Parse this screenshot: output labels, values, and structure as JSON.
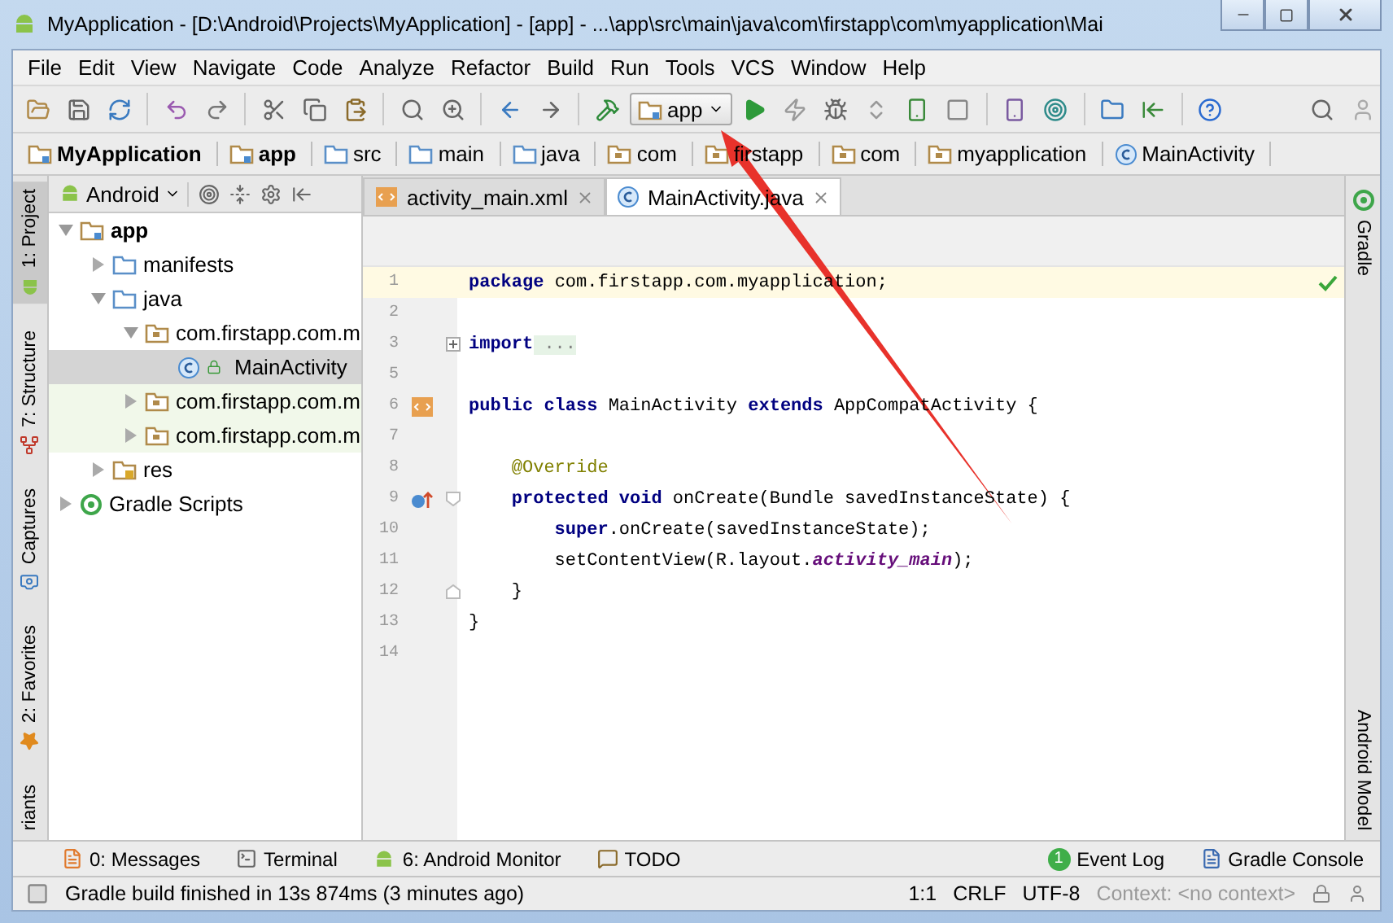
{
  "window": {
    "title": "MyApplication - [D:\\Android\\Projects\\MyApplication] - [app] - ...\\app\\src\\main\\java\\com\\firstapp\\com\\myapplication\\Mai"
  },
  "menu": [
    "File",
    "Edit",
    "View",
    "Navigate",
    "Code",
    "Analyze",
    "Refactor",
    "Build",
    "Run",
    "Tools",
    "VCS",
    "Window",
    "Help"
  ],
  "toolbar": {
    "run_config": "app"
  },
  "breadcrumbs": [
    {
      "label": "MyApplication",
      "kind": "module"
    },
    {
      "label": "app",
      "kind": "module"
    },
    {
      "label": "src",
      "kind": "folder"
    },
    {
      "label": "main",
      "kind": "folder"
    },
    {
      "label": "java",
      "kind": "source"
    },
    {
      "label": "com",
      "kind": "package"
    },
    {
      "label": "firstapp",
      "kind": "package"
    },
    {
      "label": "com",
      "kind": "package"
    },
    {
      "label": "myapplication",
      "kind": "package"
    },
    {
      "label": "MainActivity",
      "kind": "class"
    }
  ],
  "left_tool_tabs": [
    {
      "label": "1: Project",
      "selected": true,
      "kind": "android"
    },
    {
      "label": "7: Structure",
      "selected": false,
      "kind": "structure"
    },
    {
      "label": "Captures",
      "selected": false,
      "kind": "camera"
    },
    {
      "label": "2: Favorites",
      "selected": false,
      "kind": "star"
    },
    {
      "label": "riants",
      "selected": false,
      "kind": "none"
    }
  ],
  "project_panel": {
    "view": "Android",
    "tree": [
      {
        "label": "app",
        "kind": "module",
        "expanded": true,
        "selected": false,
        "children": [
          {
            "label": "manifests",
            "kind": "folder",
            "expanded": false,
            "selected": false
          },
          {
            "label": "java",
            "kind": "folder",
            "expanded": true,
            "selected": false,
            "children": [
              {
                "label": "com.firstapp.com.m",
                "kind": "package",
                "expanded": true,
                "selected": false,
                "test": false,
                "children": [
                  {
                    "label": "MainActivity",
                    "kind": "class",
                    "selected": true
                  }
                ]
              },
              {
                "label": "com.firstapp.com.m",
                "kind": "package",
                "expanded": false,
                "selected": false,
                "test": true
              },
              {
                "label": "com.firstapp.com.m",
                "kind": "package",
                "expanded": false,
                "selected": false,
                "test": true
              }
            ]
          },
          {
            "label": "res",
            "kind": "res",
            "expanded": false,
            "selected": false
          }
        ]
      },
      {
        "label": "Gradle Scripts",
        "kind": "gradle",
        "expanded": false,
        "selected": false
      }
    ]
  },
  "editor_tabs": [
    {
      "label": "activity_main.xml",
      "kind": "xml",
      "selected": false
    },
    {
      "label": "MainActivity.java",
      "kind": "class",
      "selected": true
    }
  ],
  "code_lines": [
    {
      "number": "1",
      "current": true,
      "tokens": [
        {
          "kind": "keyword",
          "text": "package"
        },
        {
          "kind": "plain",
          "text": " com.firstapp.com.myapplication;"
        }
      ]
    },
    {
      "number": "2",
      "current": false
    },
    {
      "number": "3",
      "current": false,
      "fold": {
        "kind": "plus"
      },
      "tokens": [
        {
          "kind": "keyword",
          "text": "import"
        },
        {
          "kind": "folded",
          "text": " ..."
        }
      ]
    },
    {
      "number": "5",
      "current": false
    },
    {
      "number": "6",
      "current": false,
      "gutter": {
        "kind": "layout"
      },
      "tokens": [
        {
          "kind": "keyword",
          "text": "public class"
        },
        {
          "kind": "plain",
          "text": " MainActivity "
        },
        {
          "kind": "keyword",
          "text": "extends"
        },
        {
          "kind": "plain",
          "text": " AppCompatActivity {"
        }
      ]
    },
    {
      "number": "7",
      "current": false
    },
    {
      "number": "8",
      "current": false,
      "tokens": [
        {
          "kind": "annotation",
          "text": "    @Override"
        }
      ]
    },
    {
      "number": "9",
      "current": false,
      "gutter": {
        "kind": "override"
      },
      "fold": {
        "kind": "start"
      },
      "tokens": [
        {
          "kind": "keyword",
          "text": "    protected void"
        },
        {
          "kind": "plain",
          "text": " onCreate(Bundle savedInstanceState) {"
        }
      ]
    },
    {
      "number": "10",
      "current": false,
      "tokens": [
        {
          "kind": "keyword",
          "text": "        super"
        },
        {
          "kind": "plain",
          "text": ".onCreate(savedInstanceState);"
        }
      ]
    },
    {
      "number": "11",
      "current": false,
      "tokens": [
        {
          "kind": "plain",
          "text": "        setContentView(R.layout."
        },
        {
          "kind": "field",
          "text": "activity_main"
        },
        {
          "kind": "plain",
          "text": ");"
        }
      ]
    },
    {
      "number": "12",
      "current": false,
      "fold": {
        "kind": "end"
      },
      "tokens": [
        {
          "kind": "plain",
          "text": "    }"
        }
      ]
    },
    {
      "number": "13",
      "current": false,
      "tokens": [
        {
          "kind": "plain",
          "text": "}"
        }
      ]
    },
    {
      "number": "14",
      "current": false
    }
  ],
  "right_tool_tabs": [
    {
      "label": "Gradle",
      "kind": "gradle",
      "selected": false
    },
    {
      "label": "Android Model",
      "kind": "none",
      "selected": false
    }
  ],
  "bottom_tool_tabs": {
    "left": [
      {
        "label": "0: Messages",
        "kind": "messages"
      },
      {
        "label": "Terminal",
        "kind": "terminal"
      },
      {
        "label": "6: Android Monitor",
        "kind": "android"
      },
      {
        "label": "TODO",
        "kind": "todo"
      }
    ],
    "right": [
      {
        "label": "Event Log",
        "kind": "event",
        "badge": "1"
      },
      {
        "label": "Gradle Console",
        "kind": "console"
      }
    ]
  },
  "status_bar": {
    "message": "Gradle build finished in 13s 874ms (3 minutes ago)",
    "position": "1:1",
    "line_separator": "CRLF",
    "encoding": "UTF-8",
    "context": "Context: <no context>"
  }
}
